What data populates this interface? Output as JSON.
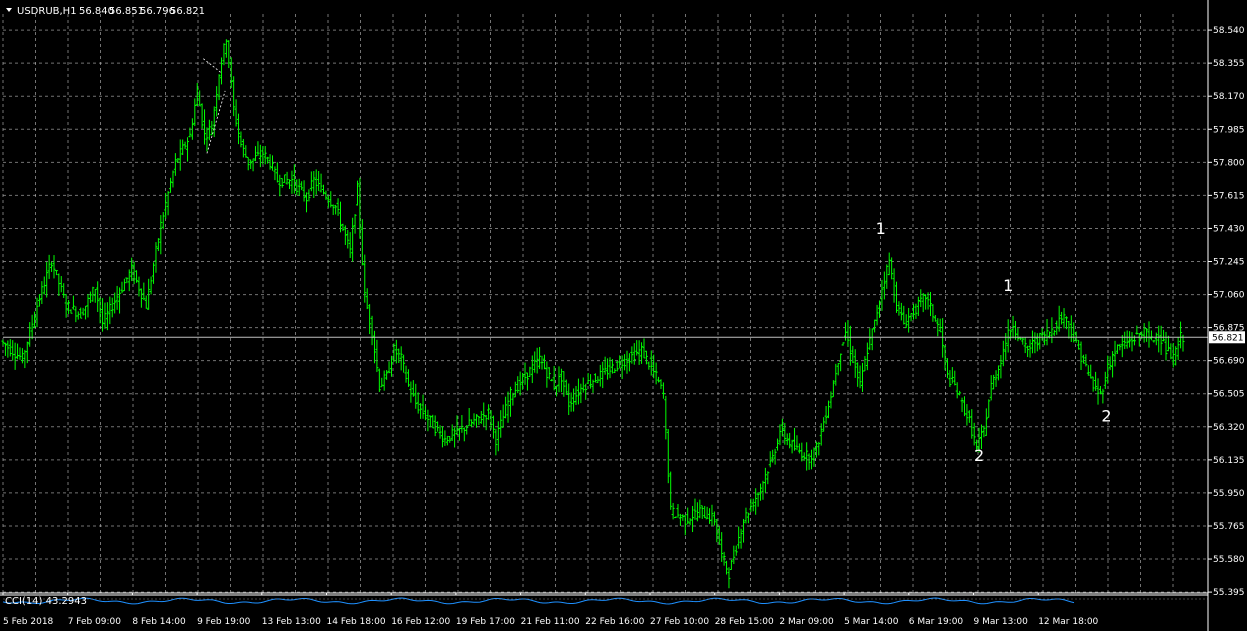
{
  "header": {
    "symbol_label": "USDRUB,H1",
    "ohlc": [
      "56.840",
      "56.851",
      "56.796",
      "56.821"
    ]
  },
  "indicator": {
    "label": "CCI(14) 43.2943"
  },
  "colors": {
    "background": "#000000",
    "grid": "#c0c0c0",
    "candle": "#00ff00",
    "price_line": "#c0c0c0",
    "cci": "#1e90ff",
    "text": "#ffffff"
  },
  "chart_data": {
    "type": "line",
    "symbol": "USDRUB",
    "timeframe": "H1",
    "ylim": [
      55.39,
      58.63
    ],
    "yticks": [
      "58.540",
      "58.355",
      "58.170",
      "57.985",
      "57.800",
      "57.615",
      "57.430",
      "57.245",
      "57.060",
      "56.875",
      "56.690",
      "56.505",
      "56.320",
      "56.135",
      "55.950",
      "55.765",
      "55.580",
      "55.395"
    ],
    "xticks": [
      "5 Feb 2018",
      "7 Feb 09:00",
      "8 Feb 14:00",
      "9 Feb 19:00",
      "13 Feb 13:00",
      "14 Feb 18:00",
      "16 Feb 12:00",
      "19 Feb 17:00",
      "21 Feb 11:00",
      "22 Feb 16:00",
      "27 Feb 10:00",
      "28 Feb 15:00",
      "2 Mar 09:00",
      "5 Mar 14:00",
      "6 Mar 19:00",
      "9 Mar 13:00",
      "12 Mar 18:00"
    ],
    "current_price": "56.821",
    "price_path": [
      [
        0,
        56.8
      ],
      [
        3,
        56.7
      ],
      [
        5,
        57.0
      ],
      [
        7,
        57.25
      ],
      [
        9,
        57.0
      ],
      [
        11,
        56.95
      ],
      [
        13,
        57.1
      ],
      [
        14,
        56.9
      ],
      [
        16,
        57.05
      ],
      [
        18,
        57.2
      ],
      [
        20,
        57.0
      ],
      [
        22,
        57.45
      ],
      [
        24,
        57.8
      ],
      [
        26,
        57.95
      ],
      [
        27,
        58.2
      ],
      [
        28,
        57.95
      ],
      [
        29,
        58.0
      ],
      [
        30,
        58.3
      ],
      [
        31,
        58.5
      ],
      [
        32,
        58.1
      ],
      [
        33,
        57.9
      ],
      [
        34,
        57.8
      ],
      [
        36,
        57.85
      ],
      [
        37,
        57.8
      ],
      [
        38,
        57.7
      ],
      [
        40,
        57.7
      ],
      [
        42,
        57.6
      ],
      [
        43,
        57.7
      ],
      [
        44,
        57.65
      ],
      [
        46,
        57.55
      ],
      [
        48,
        57.3
      ],
      [
        49,
        57.65
      ],
      [
        50,
        57.05
      ],
      [
        51,
        56.85
      ],
      [
        52,
        56.55
      ],
      [
        53,
        56.6
      ],
      [
        54,
        56.75
      ],
      [
        55,
        56.7
      ],
      [
        56,
        56.55
      ],
      [
        57,
        56.45
      ],
      [
        59,
        56.35
      ],
      [
        61,
        56.25
      ],
      [
        63,
        56.3
      ],
      [
        65,
        56.35
      ],
      [
        67,
        56.4
      ],
      [
        68,
        56.25
      ],
      [
        70,
        56.5
      ],
      [
        72,
        56.6
      ],
      [
        74,
        56.7
      ],
      [
        76,
        56.55
      ],
      [
        77,
        56.6
      ],
      [
        78,
        56.45
      ],
      [
        80,
        56.55
      ],
      [
        82,
        56.6
      ],
      [
        84,
        56.65
      ],
      [
        86,
        56.7
      ],
      [
        88,
        56.75
      ],
      [
        90,
        56.6
      ],
      [
        91,
        56.5
      ],
      [
        92,
        55.85
      ],
      [
        94,
        55.8
      ],
      [
        96,
        55.85
      ],
      [
        98,
        55.8
      ],
      [
        99,
        55.6
      ],
      [
        100,
        55.5
      ],
      [
        102,
        55.8
      ],
      [
        104,
        55.95
      ],
      [
        106,
        56.15
      ],
      [
        107,
        56.3
      ],
      [
        109,
        56.2
      ],
      [
        111,
        56.15
      ],
      [
        112,
        56.2
      ],
      [
        114,
        56.5
      ],
      [
        115,
        56.7
      ],
      [
        116,
        56.85
      ],
      [
        117,
        56.7
      ],
      [
        118,
        56.55
      ],
      [
        119,
        56.75
      ],
      [
        120,
        56.9
      ],
      [
        121,
        57.1
      ],
      [
        122,
        57.25
      ],
      [
        123,
        57.0
      ],
      [
        124,
        56.9
      ],
      [
        126,
        57.0
      ],
      [
        127,
        57.05
      ],
      [
        129,
        56.85
      ],
      [
        130,
        56.6
      ],
      [
        131,
        56.55
      ],
      [
        132,
        56.45
      ],
      [
        133,
        56.35
      ],
      [
        134,
        56.2
      ],
      [
        135,
        56.3
      ],
      [
        136,
        56.55
      ],
      [
        137,
        56.65
      ],
      [
        138,
        56.8
      ],
      [
        139,
        56.9
      ],
      [
        140,
        56.8
      ],
      [
        141,
        56.75
      ],
      [
        142,
        56.8
      ],
      [
        144,
        56.85
      ],
      [
        145,
        56.9
      ],
      [
        146,
        56.95
      ],
      [
        147,
        56.85
      ],
      [
        148,
        56.75
      ],
      [
        149,
        56.65
      ],
      [
        150,
        56.55
      ],
      [
        151,
        56.5
      ],
      [
        152,
        56.65
      ],
      [
        153,
        56.75
      ],
      [
        155,
        56.8
      ],
      [
        157,
        56.85
      ],
      [
        158,
        56.8
      ],
      [
        159,
        56.85
      ],
      [
        160,
        56.75
      ],
      [
        161,
        56.7
      ],
      [
        162,
        56.82
      ]
    ],
    "annotations": [
      {
        "text": "1",
        "x": 120.5,
        "y": 57.4
      },
      {
        "text": "1",
        "x": 138,
        "y": 57.08
      },
      {
        "text": "2",
        "x": 134,
        "y": 56.13
      },
      {
        "text": "2",
        "x": 151.5,
        "y": 56.35
      }
    ],
    "grid": true,
    "indicator_panel": {
      "name": "CCI(14)",
      "value": "43.2943"
    }
  }
}
